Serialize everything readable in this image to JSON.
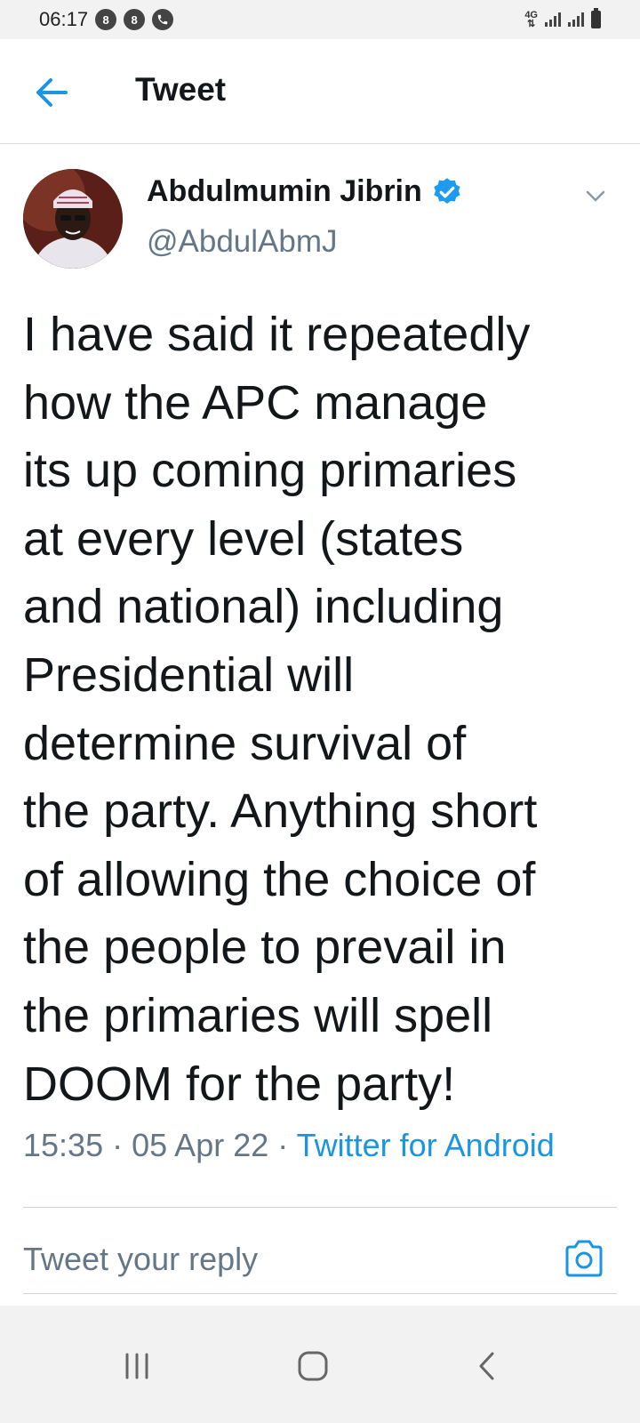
{
  "status_bar": {
    "time": "06:17",
    "notification_icons": [
      "8",
      "8"
    ],
    "network_label": "4G"
  },
  "header": {
    "title": "Tweet"
  },
  "tweet": {
    "author_name": "Abdulmumin Jibrin",
    "author_handle": "@AbdulAbmJ",
    "verified": true,
    "text": "I have said it repeatedly\nhow the APC manage\nits up coming primaries\nat  every level (states\nand national) including\nPresidential will\ndetermine survival of\nthe party. Anything short\nof allowing the choice of\nthe people to prevail in\nthe primaries will spell\nDOOM for the party!",
    "time": "15:35",
    "date": "05 Apr 22",
    "separator": "·",
    "source": "Twitter for Android"
  },
  "reply": {
    "placeholder": "Tweet your reply"
  },
  "colors": {
    "accent": "#1b95e0",
    "text_primary": "#14171a",
    "text_secondary": "#657786",
    "divider": "#ccd6dd",
    "system_bar_bg": "#f2f2f2"
  },
  "icons": {
    "back": "arrow-left-icon",
    "verified": "verified-badge-icon",
    "more": "chevron-down-icon",
    "camera": "camera-icon",
    "nav_recents": "recent-apps-icon",
    "nav_home": "home-icon",
    "nav_back": "back-chevron-icon"
  }
}
